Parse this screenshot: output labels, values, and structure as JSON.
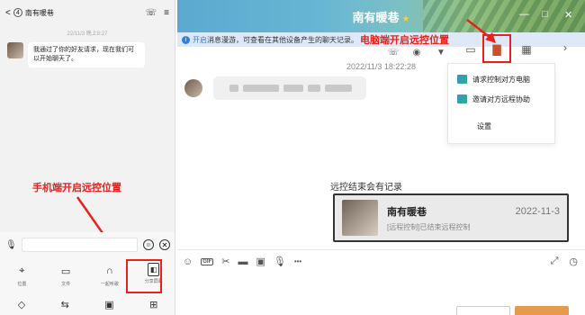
{
  "phone": {
    "back_glyph": "<",
    "unread_count": "4",
    "contact": "南有暖巷",
    "call_glyph": "☏",
    "menu_glyph": "≡",
    "time": "22/11/3 晚上8:27",
    "message": "我通过了你的好友请求，现在我们可以开始聊天了。",
    "annotation": "手机端开启远控位置",
    "mic_glyph": "🎙",
    "emoji_glyph": "☺",
    "close_glyph": "✕",
    "tools": [
      {
        "icon": "⌖",
        "label": "位置"
      },
      {
        "icon": "▭",
        "label": "文件"
      },
      {
        "icon": "∩",
        "label": "一起听歌"
      },
      {
        "icon": "◧",
        "label": "分享屏幕"
      }
    ],
    "bottom_icons": [
      "◇",
      "⇆",
      "▣",
      "⊞"
    ]
  },
  "window": {
    "title": "南有暖巷",
    "star": "★",
    "minimize": "—",
    "maximize": "□",
    "close": "✕",
    "notice_link": "开启",
    "notice_text": "消息漫游，可查看在其他设备产生的聊天记录。",
    "notice_annotation": "电脑端开启远控位置",
    "chat_time": "2022/11/3 18:22:28",
    "menu": {
      "item1": "请求控制对方电脑",
      "item2": "邀请对方远程协助",
      "item3": "设置"
    },
    "end_label": "远控结束会有记录",
    "card": {
      "name": "南有暖巷",
      "sub": "[远程控制]已结束远程控制",
      "date": "2022-11-3"
    },
    "input_icons": {
      "emoji": "☺",
      "gif": "GIF",
      "scissors": "✂",
      "folder": "▬",
      "image": "▣",
      "mic": "🎙",
      "more": "•••",
      "expand": "⤢",
      "clock": "◷"
    }
  },
  "colors": {
    "annotation_red": "#e8211c",
    "link_blue": "#2f80d8",
    "notice_bg": "#dde9f7",
    "send_orange": "#e59a4e"
  }
}
